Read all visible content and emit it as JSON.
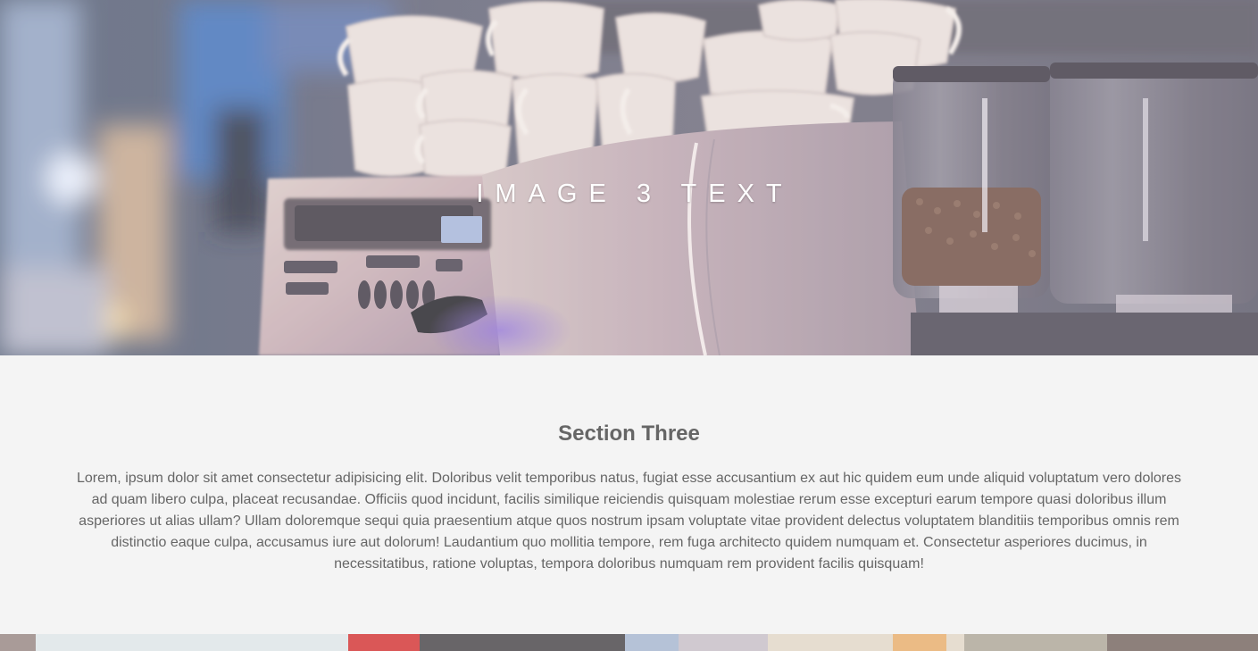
{
  "hero": {
    "caption": "IMAGE 3 TEXT"
  },
  "section": {
    "title": "Section Three",
    "body": "Lorem, ipsum dolor sit amet consectetur adipisicing elit. Doloribus velit temporibus natus, fugiat esse accusantium ex aut hic quidem eum unde aliquid voluptatum vero dolores ad quam libero culpa, placeat recusandae. Officiis quod incidunt, facilis similique reiciendis quisquam molestiae rerum esse excepturi earum tempore quasi doloribus illum asperiores ut alias ullam? Ullam doloremque sequi quia praesentium atque quos nostrum ipsam voluptate vitae provident delectus voluptatem blanditiis temporibus omnis rem distinctio eaque culpa, accusamus iure aut dolorum! Laudantium quo mollitia tempore, rem fuga architecto quidem numquam et. Consectetur asperiores ducimus, in necessitatibus, ratione voluptas, tempora doloribus numquam rem provident facilis quisquam!"
  },
  "colors": {
    "section_background": "#f4f4f4",
    "text": "#666666",
    "hero_caption": "#ffffff"
  }
}
